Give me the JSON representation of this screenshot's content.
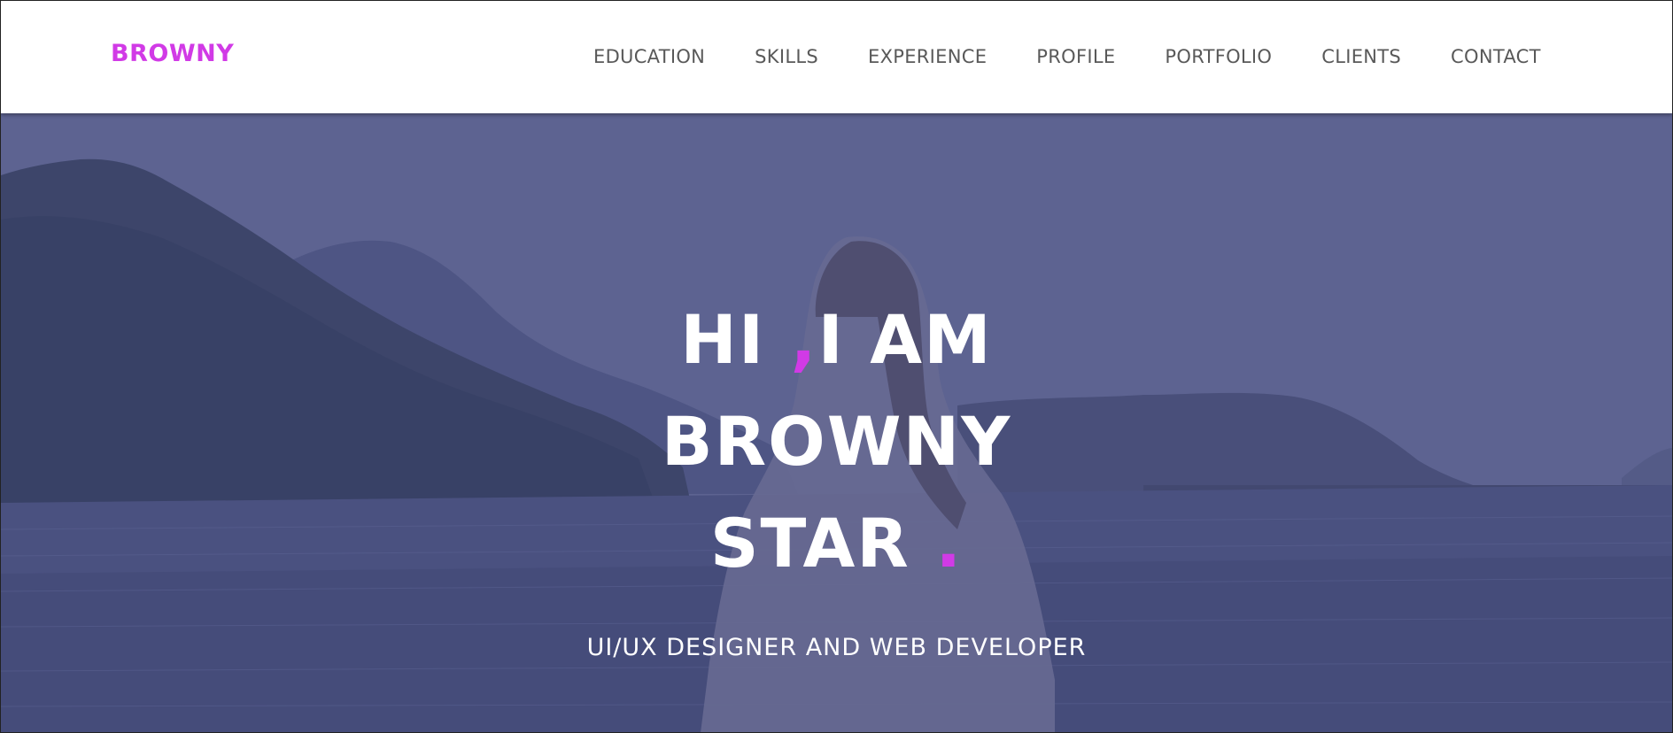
{
  "brand": {
    "name": "BROWNY",
    "color": "#d13ae6"
  },
  "nav": {
    "items": [
      "EDUCATION",
      "SKILLS",
      "EXPERIENCE",
      "PROFILE",
      "PORTFOLIO",
      "CLIENTS",
      "CONTACT"
    ]
  },
  "hero": {
    "line1_a": "HI",
    "line1_comma": ",",
    "line1_b": "I AM",
    "line2": "BROWNY",
    "line3": "STAR",
    "line3_dot": ".",
    "subtitle": "UI/UX DESIGNER AND WEB DEVELOPER",
    "overlay_color": "#5a6190",
    "background_image": "person-at-lake-photo"
  },
  "colors": {
    "accent": "#d13ae6",
    "nav_text": "#595959",
    "hero_text": "#ffffff"
  }
}
